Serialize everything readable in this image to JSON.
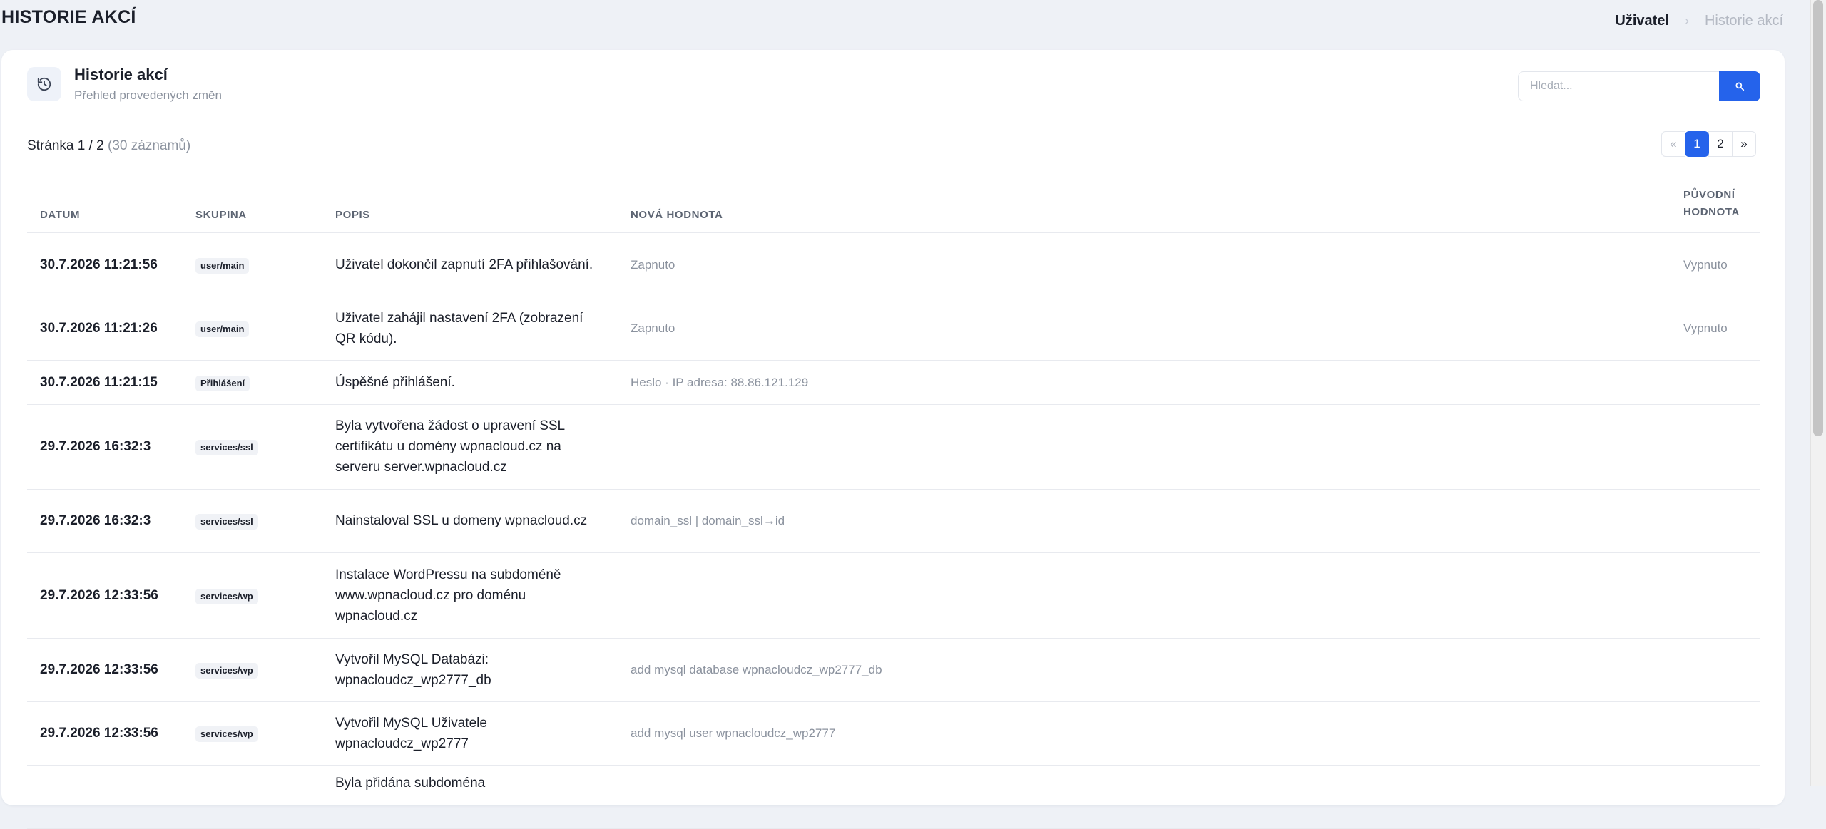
{
  "page": {
    "heading": "HISTORIE AKCÍ",
    "breadcrumb": {
      "home": "Uživatel",
      "separator": "›",
      "current": "Historie akcí"
    }
  },
  "card": {
    "title": "Historie akcí",
    "subtitle": "Přehled provedených změn",
    "icon": "history-icon"
  },
  "search": {
    "placeholder": "Hledat...",
    "button_icon": "search-icon"
  },
  "pagination_info": {
    "label": "Stránka 1 / 2",
    "count": "(30 záznamů)"
  },
  "pagination": {
    "prev": "«",
    "pages": [
      "1",
      "2"
    ],
    "next": "»",
    "active": "1"
  },
  "table": {
    "columns": {
      "date": "DATUM",
      "group": "SKUPINA",
      "desc": "POPIS",
      "new_value": "NOVÁ HODNOTA",
      "old_value": "PŮVODNÍ HODNOTA"
    },
    "rows": [
      {
        "date": "30.7.2026 11:21:56",
        "group": "user/main",
        "desc": "Uživatel dokončil zapnutí 2FA přihlašování.",
        "new_value": "Zapnuto",
        "old_value": "Vypnuto"
      },
      {
        "date": "30.7.2026 11:21:26",
        "group": "user/main",
        "desc": "Uživatel zahájil nastavení 2FA (zobrazení QR kódu).",
        "new_value": "Zapnuto",
        "old_value": "Vypnuto"
      },
      {
        "date": "30.7.2026 11:21:15",
        "group": "Přihlášení",
        "desc": "Úspěšné přihlášení.",
        "new_value": "Heslo · IP adresa: 88.86.121.129",
        "old_value": ""
      },
      {
        "date": "29.7.2026 16:32:3",
        "group": "services/ssl",
        "desc": "Byla vytvořena žádost o upravení SSL certifikátu u domény wpnacloud.cz na serveru server.wpnacloud.cz",
        "new_value": "",
        "old_value": ""
      },
      {
        "date": "29.7.2026 16:32:3",
        "group": "services/ssl",
        "desc": "Nainstaloval SSL u domeny wpnacloud.cz",
        "new_value": "domain_ssl | domain_ssl→id",
        "old_value": ""
      },
      {
        "date": "29.7.2026 12:33:56",
        "group": "services/wp",
        "desc": "Instalace WordPressu na subdoméně www.wpnacloud.cz pro doménu wpnacloud.cz",
        "new_value": "",
        "old_value": ""
      },
      {
        "date": "29.7.2026 12:33:56",
        "group": "services/wp",
        "desc": "Vytvořil MySQL Databázi: wpnacloudcz_wp2777_db",
        "new_value": "add mysql database wpnacloudcz_wp2777_db",
        "old_value": ""
      },
      {
        "date": "29.7.2026 12:33:56",
        "group": "services/wp",
        "desc": "Vytvořil MySQL Uživatele wpnacloudcz_wp2777",
        "new_value": "add mysql user wpnacloudcz_wp2777",
        "old_value": ""
      },
      {
        "date": "",
        "group": "",
        "desc": "Byla přidána subdoména",
        "new_value": "",
        "old_value": ""
      }
    ]
  }
}
